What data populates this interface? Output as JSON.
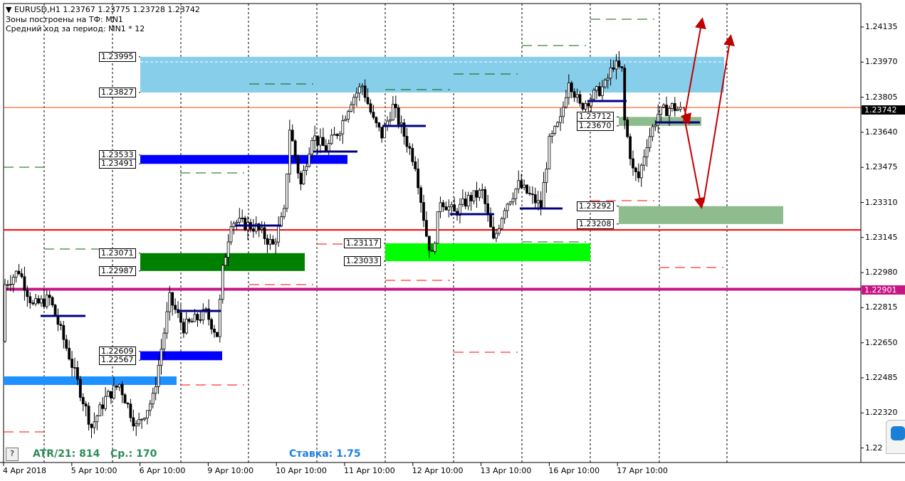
{
  "header": {
    "symbol_line": "EURUSD,H1  1.23767 1.23775 1.23728 1.23742",
    "zones_tf": "Зоны построены на ТФ: MN1",
    "avg_move": "Средний ход за период: MN1 * 12"
  },
  "indicators": {
    "atr": "ATR/21: 814",
    "avg": "Ср.: 170",
    "rate": "Ставка: 1.75",
    "help": "?"
  },
  "current_price": "1.23742",
  "current_price_color": "#000000",
  "level_badge": "1.22901",
  "level_badge_color": "#c71585",
  "zones": [
    {
      "top": "1.23995",
      "bottom": "1.23827",
      "color": "#87ceeb"
    },
    {
      "top": "1.23533",
      "bottom": "1.23491",
      "color": "#0000ff"
    },
    {
      "top": "1.23071",
      "bottom": "1.22987",
      "color": "#008000"
    },
    {
      "top": "1.23117",
      "bottom": "1.23033",
      "color": "#00ff00"
    },
    {
      "top": "1.22609",
      "bottom": "1.22567",
      "color": "#0000ff"
    },
    {
      "top": "1.23712",
      "bottom": "1.23670",
      "color": "#8fbc8f"
    },
    {
      "top": "1.23292",
      "bottom": "1.23208",
      "color": "#8fbc8f"
    }
  ],
  "chart_data": {
    "type": "candlestick",
    "symbol": "EURUSD",
    "timeframe": "H1",
    "ylim": [
      1.22,
      1.2432
    ],
    "y_ticks": [
      "1.24135",
      "1.23970",
      "1.23805",
      "1.23640",
      "1.23475",
      "1.23310",
      "1.23145",
      "1.22980",
      "1.22815",
      "1.22650",
      "1.22485",
      "1.22320",
      "1.22"
    ],
    "x_ticks": [
      "4 Apr 2018",
      "5 Apr 10:00",
      "6 Apr 10:00",
      "9 Apr 10:00",
      "10 Apr 10:00",
      "11 Apr 10:00",
      "12 Apr 10:00",
      "13 Apr 10:00",
      "16 Apr 10:00",
      "17 Apr 10:00"
    ],
    "price_path_bar_price": [
      [
        0,
        1.22655
      ],
      [
        1,
        1.22923
      ],
      [
        6,
        1.2299
      ],
      [
        11,
        1.22822
      ],
      [
        17,
        1.22856
      ],
      [
        24,
        1.22588
      ],
      [
        32,
        1.22253
      ],
      [
        37,
        1.22387
      ],
      [
        42,
        1.22454
      ],
      [
        48,
        1.22253
      ],
      [
        54,
        1.22387
      ],
      [
        60,
        1.22856
      ],
      [
        65,
        1.22722
      ],
      [
        73,
        1.22789
      ],
      [
        77,
        1.22688
      ],
      [
        79,
        1.2299
      ],
      [
        82,
        1.23224
      ],
      [
        91,
        1.23191
      ],
      [
        97,
        1.23107
      ],
      [
        101,
        1.23258
      ],
      [
        103,
        1.23659
      ],
      [
        107,
        1.23392
      ],
      [
        111,
        1.23626
      ],
      [
        116,
        1.23559
      ],
      [
        121,
        1.23659
      ],
      [
        125,
        1.23793
      ],
      [
        129,
        1.2386
      ],
      [
        133,
        1.23693
      ],
      [
        136,
        1.23626
      ],
      [
        140,
        1.2376
      ],
      [
        144,
        1.23626
      ],
      [
        148,
        1.23492
      ],
      [
        152,
        1.23157
      ],
      [
        154,
        1.23057
      ],
      [
        157,
        1.23325
      ],
      [
        162,
        1.23258
      ],
      [
        167,
        1.23325
      ],
      [
        172,
        1.23358
      ],
      [
        176,
        1.23124
      ],
      [
        180,
        1.23291
      ],
      [
        185,
        1.23392
      ],
      [
        193,
        1.23291
      ],
      [
        196,
        1.23592
      ],
      [
        200,
        1.23693
      ],
      [
        203,
        1.23894
      ],
      [
        207,
        1.2376
      ],
      [
        210,
        1.23793
      ],
      [
        216,
        1.2386
      ],
      [
        219,
        1.23961
      ],
      [
        222,
        1.23927
      ],
      [
        223,
        1.23693
      ],
      [
        226,
        1.23459
      ],
      [
        228,
        1.23425
      ],
      [
        231,
        1.23592
      ],
      [
        235,
        1.23726
      ],
      [
        240,
        1.2376
      ],
      [
        243,
        1.23742
      ]
    ],
    "horizontal_levels": [
      {
        "price": 1.23756,
        "color": "#ff4500"
      },
      {
        "price": 1.2318,
        "color": "#ff0000"
      },
      {
        "price": 1.22901,
        "color": "#c71585"
      }
    ]
  }
}
